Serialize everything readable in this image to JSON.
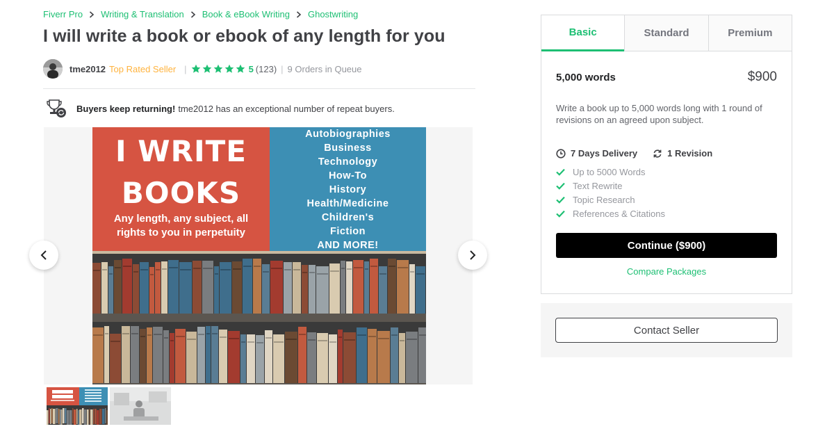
{
  "breadcrumb": [
    {
      "label": "Fiverr Pro"
    },
    {
      "label": "Writing & Translation"
    },
    {
      "label": "Book & eBook Writing"
    },
    {
      "label": "Ghostwriting"
    }
  ],
  "gig": {
    "title": "I will write a book or ebook of any length for you"
  },
  "seller": {
    "name": "tme2012",
    "level": "Top Rated Seller",
    "rating": "5",
    "reviews": "(123)",
    "queue": "9 Orders in Queue"
  },
  "repeat": {
    "strong": "Buyers keep returning!",
    "text": "tme2012 has an exceptional number of repeat buyers."
  },
  "gallery": {
    "headline_1": "I WRITE",
    "headline_2": "BOOKS",
    "subtitle": "Any length, any subject, all rights to you in perpetuity",
    "topics": [
      "Autobiographies",
      "Business",
      "Technology",
      "How-To",
      "History",
      "Health/Medicine",
      "Children's",
      "Fiction",
      "AND MORE!"
    ]
  },
  "packages": {
    "tabs": [
      "Basic",
      "Standard",
      "Premium"
    ],
    "active_tab": "Basic",
    "name": "5,000 words",
    "price": "$900",
    "description": "Write a book up to 5,000 words long with 1 round of revisions on an agreed upon subject.",
    "delivery": "7 Days Delivery",
    "revisions": "1 Revision",
    "features": [
      "Up to 5000 Words",
      "Text Rewrite",
      "Topic Research",
      "References & Citations"
    ],
    "continue_label": "Continue ($900)",
    "compare_label": "Compare Packages"
  },
  "contact": {
    "label": "Contact Seller"
  },
  "colors": {
    "brand_green": "#1dbf73",
    "top_rated": "#ffb33e",
    "text": "#404145",
    "muted": "#95979d",
    "slide_red": "#d65442",
    "slide_blue": "#3d8fb4"
  },
  "icons": {
    "breadcrumb_separator": "chevron-right-icon",
    "rating": "star-icon",
    "repeat": "trophy-icon",
    "delivery": "clock-icon",
    "revisions": "refresh-icon",
    "feature": "check-icon",
    "gallery_prev": "chevron-left-icon",
    "gallery_next": "chevron-right-icon"
  }
}
